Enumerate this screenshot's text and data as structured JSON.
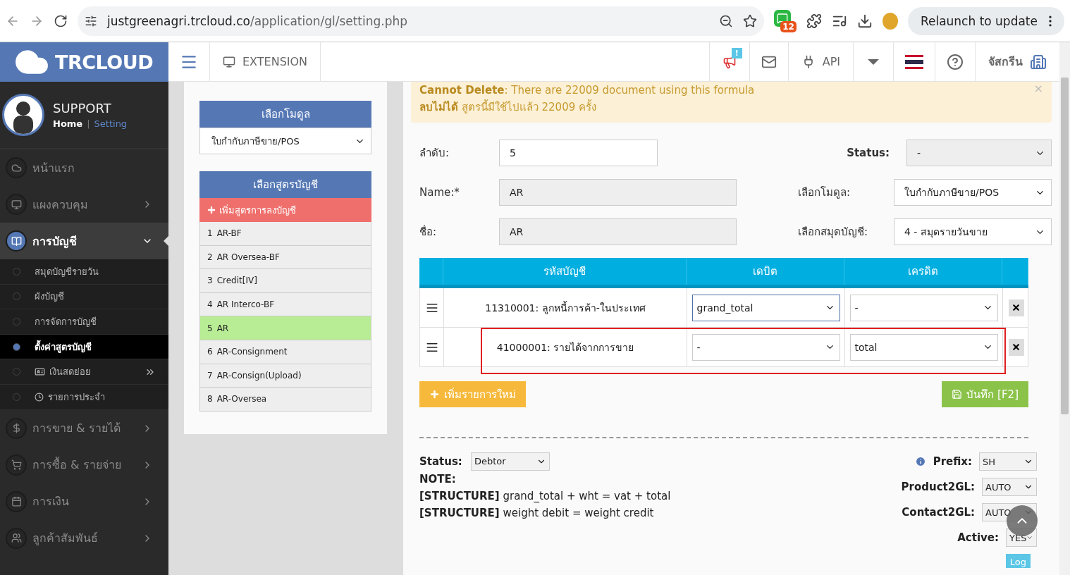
{
  "browser": {
    "url_host": "justgreenagri.trcloud.co",
    "url_path": "/application/gl/setting.php",
    "extension_badge": "12",
    "relaunch": "Relaunch to update"
  },
  "header": {
    "logo": "TRCLOUD",
    "extension": "EXTENSION",
    "notice_badge": "!",
    "api": "API",
    "user": "จัสกรีน"
  },
  "profile": {
    "name": "SUPPORT",
    "home": "Home",
    "separator": "|",
    "setting": "Setting"
  },
  "sidebar": {
    "items": [
      {
        "label": "หน้าแรก",
        "selected": false,
        "expanded": false,
        "has_submenu": false
      },
      {
        "label": "แผงควบคุม",
        "selected": false,
        "expanded": false,
        "has_submenu": true
      },
      {
        "label": "การบัญชี",
        "selected": true,
        "expanded": true,
        "has_submenu": true,
        "children": [
          {
            "label": "สมุดบัญชีรายวัน",
            "selected": false,
            "has_submenu": false
          },
          {
            "label": "ผังบัญชี",
            "selected": false,
            "has_submenu": false
          },
          {
            "label": "การจัดการบัญชี",
            "selected": false,
            "has_submenu": false
          },
          {
            "label": "ตั้งค่าสูตรบัญชี",
            "selected": true,
            "has_submenu": false
          },
          {
            "label": "เงินสดย่อย",
            "selected": false,
            "has_submenu": true
          },
          {
            "label": "รายการประจำ",
            "selected": false,
            "has_submenu": false
          }
        ]
      },
      {
        "label": "การขาย & รายได้",
        "selected": false,
        "expanded": false,
        "has_submenu": true
      },
      {
        "label": "การซื้อ & รายจ่าย",
        "selected": false,
        "expanded": false,
        "has_submenu": true
      },
      {
        "label": "การเงิน",
        "selected": false,
        "expanded": false,
        "has_submenu": true
      },
      {
        "label": "ลูกค้าสัมพันธ์",
        "selected": false,
        "expanded": false,
        "has_submenu": true
      }
    ]
  },
  "module_picker": {
    "title": "เลือกโมดูล",
    "value": "ใบกำกับภาษีขาย/POS"
  },
  "formulas": {
    "title": "เลือกสูตรบัญชี",
    "add_label": "เพิ่มสูตรการลงบัญชี",
    "items": [
      {
        "number": "1",
        "name": "AR-BF",
        "selected": false
      },
      {
        "number": "2",
        "name": "AR Oversea-BF",
        "selected": false
      },
      {
        "number": "3",
        "name": "Credit[IV]",
        "selected": false
      },
      {
        "number": "4",
        "name": "AR Interco-BF",
        "selected": false
      },
      {
        "number": "5",
        "name": "AR",
        "selected": true
      },
      {
        "number": "6",
        "name": "AR-Consignment",
        "selected": false
      },
      {
        "number": "7",
        "name": "AR-Consign(Upload)",
        "selected": false
      },
      {
        "number": "8",
        "name": "AR-Oversea",
        "selected": false
      }
    ]
  },
  "alert": {
    "lines": [
      "**Cannot Delete**: There are 22009 document using this formula",
      "**ลบไม่ได้** สูตรนี้มีใช้ไปแล้ว 22009 ครั้ง"
    ],
    "close": "×"
  },
  "form": {
    "left": [
      {
        "label": "ลำดับ:",
        "value": "5",
        "kind": "input",
        "bold": false
      },
      {
        "label": "Name:*",
        "value": "AR",
        "kind": "readonly",
        "bold": false
      },
      {
        "label": "ชื่อ:",
        "value": "AR",
        "kind": "readonly",
        "bold": false
      }
    ],
    "right": [
      {
        "label": "Status:",
        "value": "-",
        "kind": "select-readonly",
        "bold": true
      },
      {
        "label": "เลือกโมดูล:",
        "value": "ใบกำกับภาษีขาย/POS",
        "kind": "select",
        "bold": false
      },
      {
        "label": "เลือกสมุดบัญชี:",
        "value": "4 - สมุดรายวันขาย",
        "kind": "select",
        "bold": false
      }
    ]
  },
  "table": {
    "columns": [
      "รหัสบัญชี",
      "เดบิต",
      "เครดิต"
    ],
    "rows": [
      {
        "account": "11310001: ลูกหนี้การค้า-ในประเทศ",
        "debit": "grand_total",
        "credit": "-",
        "debit_focused": true,
        "highlighted": false
      },
      {
        "account": "41000001: รายได้จากการขาย",
        "debit": "-",
        "credit": "total",
        "debit_focused": false,
        "highlighted": true
      }
    ]
  },
  "buttons": {
    "add_row": "เพิ่มรายการใหม่",
    "save": "บันทึก [F2]"
  },
  "footer": {
    "status_label": "Status:",
    "status_value": "Debtor",
    "note_title": "NOTE:",
    "notes": [
      "**[STRUCTURE]** grand_total + wht = vat + total",
      "**[STRUCTURE]** weight debit = weight credit"
    ],
    "settings": [
      {
        "label": "Prefix:",
        "value": "SH",
        "info": true
      },
      {
        "label": "Product2GL:",
        "value": "AUTO",
        "info": false
      },
      {
        "label": "Contact2GL:",
        "value": "AUTO",
        "info": false
      },
      {
        "label": "Active:",
        "value": "YES",
        "info": false
      }
    ],
    "log": "Log"
  }
}
